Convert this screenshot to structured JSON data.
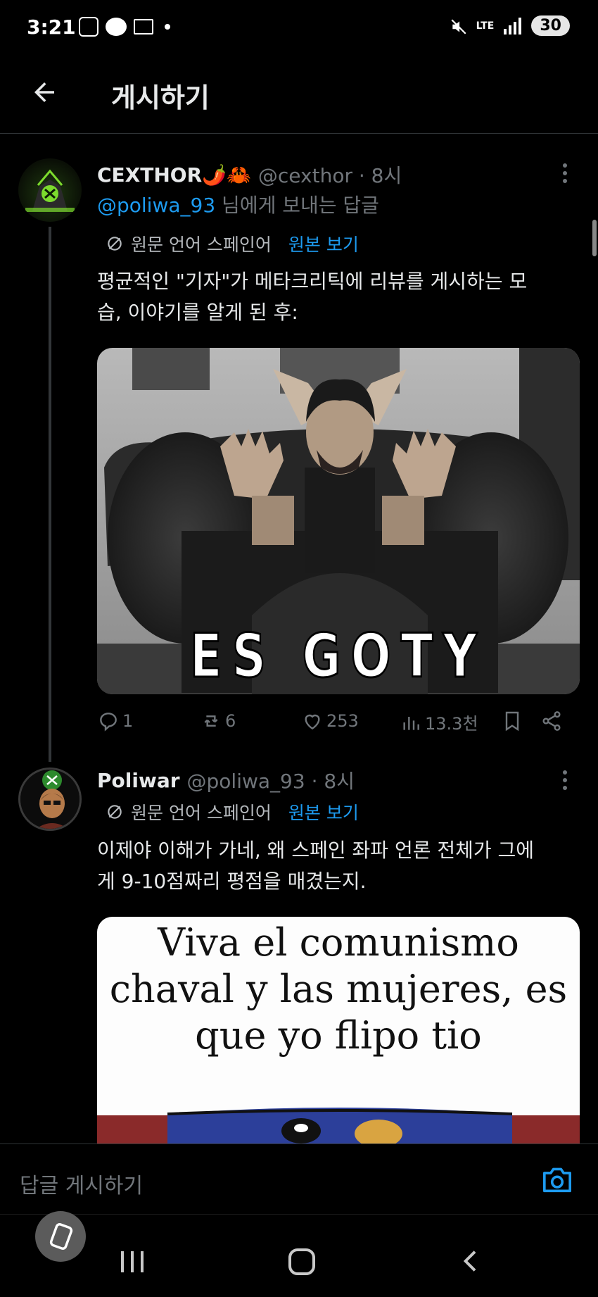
{
  "status_bar": {
    "time": "3:21",
    "network": "LTE",
    "battery": "30"
  },
  "header": {
    "title": "게시하기"
  },
  "tweets": [
    {
      "name": "CEXTHOR🌶️🦀",
      "handle": "@cexthor · 8시",
      "reply_to_mention": "@poliwa_93",
      "reply_to_suffix": " 님에게 보내는 답글",
      "translation_note": "원문 언어 스페인어",
      "show_original": "원본 보기",
      "text": "평균적인 \"기자\"가 메타크리틱에 리뷰를 게시하는 모습, 이야기를 알게 된 후:",
      "image_caption": "ES GOTY",
      "actions": {
        "replies": "1",
        "reposts": "6",
        "likes": "253",
        "views": "13.3천"
      }
    },
    {
      "name": "Poliwar",
      "handle": "@poliwa_93 · 8시",
      "translation_note": "원문 언어 스페인어",
      "show_original": "원본 보기",
      "text": "이제야 이해가 가네, 왜 스페인 좌파 언론 전체가 그에게 9-10점짜리 평점을 매겼는지.",
      "image_caption": "Viva el comunismo chaval y las mujeres, es que yo flipo tio"
    }
  ],
  "reply_bar": {
    "placeholder": "답글 게시하기"
  },
  "colors": {
    "background": "#000000",
    "accent": "#1d9bf0",
    "muted": "#71767b",
    "divider": "#2f3336"
  }
}
